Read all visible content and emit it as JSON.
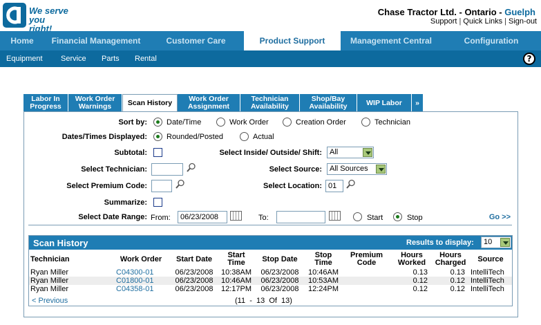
{
  "logo": {
    "line1": "We serve",
    "line2": "you right!"
  },
  "company": {
    "name": "Chase Tractor Ltd. - Ontario - ",
    "city": "Guelph"
  },
  "toplinks": [
    "Support",
    "Quick Links",
    "Sign-out"
  ],
  "mainnav": [
    {
      "label": "Home"
    },
    {
      "label": "Financial Management"
    },
    {
      "label": "Customer Care"
    },
    {
      "label": "Product Support",
      "active": true
    },
    {
      "label": "Management Central"
    },
    {
      "label": "Configuration"
    }
  ],
  "subnav": [
    "Equipment",
    "Service",
    "Parts",
    "Rental"
  ],
  "help": "?",
  "tabs": [
    {
      "label": "Labor In Progress"
    },
    {
      "label": "Work Order Warnings"
    },
    {
      "label": "Scan History",
      "active": true
    },
    {
      "label": "Work Order Assignment"
    },
    {
      "label": "Technician Availability"
    },
    {
      "label": "Shop/Bay Availability"
    },
    {
      "label": "WIP Labor"
    },
    {
      "label": "»"
    }
  ],
  "form": {
    "sort_by_label": "Sort by:",
    "sort_options": [
      "Date/Time",
      "Work Order",
      "Creation Order",
      "Technician"
    ],
    "dates_label": "Dates/Times Displayed:",
    "dates_options": [
      "Rounded/Posted",
      "Actual"
    ],
    "subtotal_label": "Subtotal:",
    "shift_label": "Select Inside/ Outside/ Shift:",
    "shift_value": "All",
    "technician_label": "Select Technician:",
    "technician_value": "",
    "source_label": "Select Source:",
    "source_value": "All Sources",
    "premium_label": "Select Premium Code:",
    "premium_value": "",
    "location_label": "Select Location:",
    "location_value": "01",
    "summarize_label": "Summarize:",
    "daterange_label": "Select Date Range:",
    "from_label": "From:",
    "from_value": "06/23/2008",
    "to_label": "To:",
    "to_value": "",
    "start_label": "Start",
    "stop_label": "Stop",
    "go_label": "Go >>"
  },
  "results": {
    "title": "Scan History",
    "results_label": "Results to display:",
    "results_value": "10",
    "columns": [
      "Technician",
      "Work Order",
      "Start Date",
      "Start Time",
      "Stop Date",
      "Stop Time",
      "Premium Code",
      "Hours Worked",
      "Hours Charged",
      "Source"
    ],
    "rows": [
      [
        "Ryan Miller",
        "C04300-01",
        "06/23/2008",
        "10:38AM",
        "06/23/2008",
        "10:46AM",
        "",
        "0.13",
        "0.13",
        "IntelliTech"
      ],
      [
        "Ryan Miller",
        "C01800-01",
        "06/23/2008",
        "10:46AM",
        "06/23/2008",
        "10:53AM",
        "",
        "0.12",
        "0.12",
        "IntelliTech"
      ],
      [
        "Ryan Miller",
        "C04358-01",
        "06/23/2008",
        "12:17PM",
        "06/23/2008",
        "12:24PM",
        "",
        "0.12",
        "0.12",
        "IntelliTech"
      ]
    ],
    "previous_label": "< Previous",
    "pager_text": "(11  -  13  Of  13)"
  }
}
